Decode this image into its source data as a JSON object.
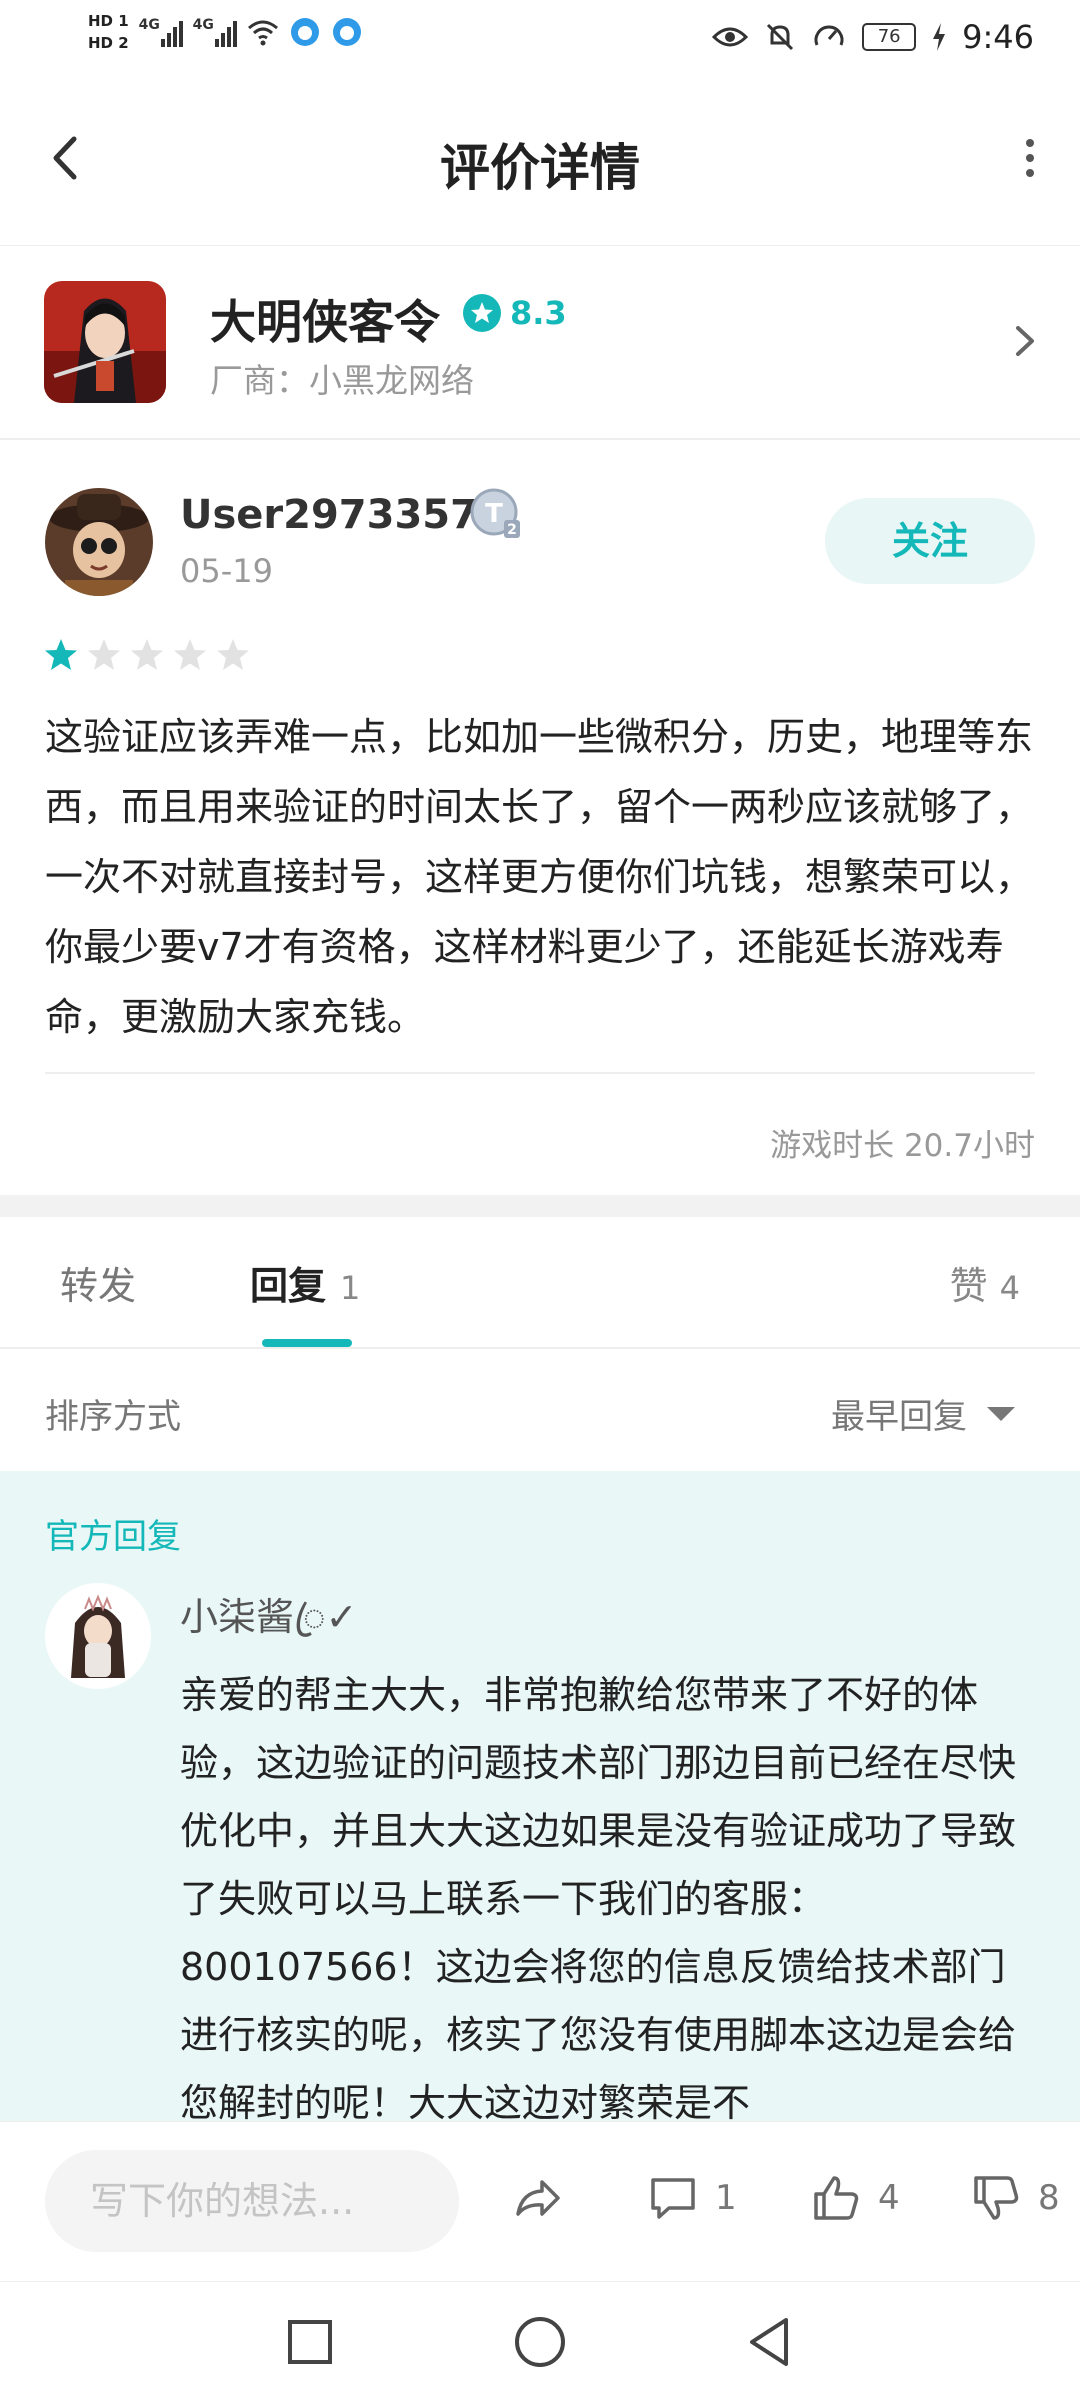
{
  "status_bar": {
    "hd1": "HD 1",
    "hd2": "HD 2",
    "net1": "4G",
    "net2": "4G",
    "battery": "76",
    "time": "9:46"
  },
  "header": {
    "title": "评价详情"
  },
  "game": {
    "name": "大明侠客令",
    "rating": "8.3",
    "developer": "厂商：小黑龙网络"
  },
  "review": {
    "username": "User29733577",
    "badge": "T2",
    "date": "05-19",
    "follow_label": "关注",
    "stars_filled": 1,
    "stars_total": 5,
    "text": "这验证应该弄难一点，比如加一些微积分，历史，地理等东西，而且用来验证的时间太长了，留个一两秒应该就够了，一次不对就直接封号，这样更方便你们坑钱，想繁荣可以，你最少要v7才有资格，这样材料更少了，还能延长游戏寿命，更激励大家充钱。",
    "playtime": "游戏时长 20.7小时"
  },
  "tabs": {
    "repost": "转发",
    "reply": "回复",
    "reply_count": "1",
    "like": "赞",
    "like_count": "4"
  },
  "sort": {
    "label": "排序方式",
    "selected": "最早回复"
  },
  "official_reply": {
    "label": "官方回复",
    "username": "小柒酱ꦿ✓",
    "text": "亲爱的帮主大大，非常抱歉给您带来了不好的体验，这边验证的问题技术部门那边目前已经在尽快优化中，并且大大这边如果是没有验证成功了导致了失败可以马上联系一下我们的客服：800107566！这边会将您的信息反馈给技术部门进行核实的呢，核实了您没有使用脚本这边是会给您解封的呢！大大这边对繁荣是不"
  },
  "bottom_bar": {
    "input_placeholder": "写下你的想法...",
    "comment_count": "1",
    "like_count": "4",
    "dislike_count": "8"
  },
  "colors": {
    "accent": "#15b8b8",
    "official_bg": "#e9f7f7"
  }
}
